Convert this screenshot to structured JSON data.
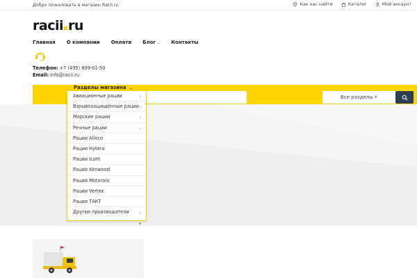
{
  "topbar": {
    "welcome": "Добро пожаловать в магазин Racii.ru",
    "links": [
      {
        "label": "Как нас найти",
        "icon": "location-pin-icon"
      },
      {
        "label": "Каталог",
        "icon": "shopping-bag-icon"
      },
      {
        "label": "Мой аккаунт",
        "icon": "user-icon"
      }
    ]
  },
  "logo": {
    "left": "racii",
    "right": "ru"
  },
  "nav": {
    "items": [
      "Главная",
      "О компании",
      "Оплата",
      "Блог",
      "Контакты"
    ]
  },
  "contact": {
    "phone_label": "Телефон:",
    "phone": "+7 (495) 899-01-50",
    "email_label": "Email:",
    "email": "info@racii.ru"
  },
  "search": {
    "placeholder": "",
    "category_select": "Все разделы",
    "categories_toggle": "Разделы магазина"
  },
  "categories": [
    {
      "label": "Авиационные рации",
      "has_sub": true
    },
    {
      "label": "Взрывозащищённые рации",
      "has_sub": true
    },
    {
      "label": "Морские рации",
      "has_sub": true
    },
    {
      "label": "Речные рации",
      "has_sub": true
    },
    {
      "label": "Рации Alinco",
      "has_sub": false
    },
    {
      "label": "Рации Hytera",
      "has_sub": false
    },
    {
      "label": "Рации Icom",
      "has_sub": false
    },
    {
      "label": "Рации Kenwood",
      "has_sub": false
    },
    {
      "label": "Рации Motorola",
      "has_sub": false
    },
    {
      "label": "Рации Vertex",
      "has_sub": false
    },
    {
      "label": "Рации ТАКТ",
      "has_sub": false
    },
    {
      "label": "Другие производители",
      "has_sub": true
    }
  ],
  "colors": {
    "accent": "#ffd400",
    "dark_button": "#2c3e50"
  }
}
